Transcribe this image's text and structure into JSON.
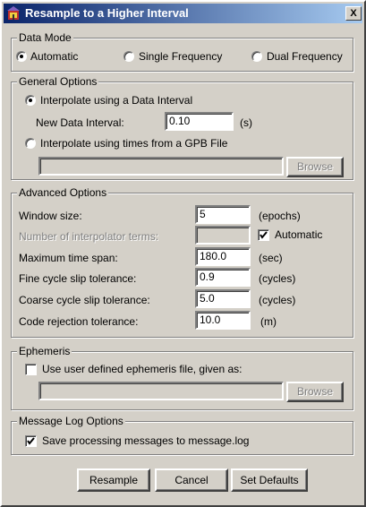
{
  "window": {
    "title": "Resample to a Higher Interval",
    "close_glyph": "X",
    "icon": "app-icon"
  },
  "data_mode": {
    "legend": "Data Mode",
    "options": [
      "Automatic",
      "Single Frequency",
      "Dual Frequency"
    ],
    "selected": "Automatic"
  },
  "general_options": {
    "legend": "General Options",
    "interpolate_interval_label": "Interpolate using a Data Interval",
    "interpolate_interval_selected": true,
    "new_data_interval_label": "New Data Interval:",
    "new_data_interval_value": "0.10",
    "new_data_interval_unit": "(s)",
    "interpolate_gpb_label": "Interpolate using times from a GPB File",
    "interpolate_gpb_selected": false,
    "gpb_file_value": "",
    "browse_label": "Browse"
  },
  "advanced_options": {
    "legend": "Advanced Options",
    "rows": [
      {
        "label": "Window size:",
        "value": "5",
        "unit": "(epochs)"
      },
      {
        "label": "Number of interpolator terms:",
        "value": "",
        "unit": "",
        "disabled": true,
        "checkbox_label": "Automatic",
        "checkbox_checked": true
      },
      {
        "label": "Maximum time span:",
        "value": "180.0",
        "unit": "(sec)"
      },
      {
        "label": "Fine cycle slip tolerance:",
        "value": "0.9",
        "unit": "(cycles)"
      },
      {
        "label": "Coarse cycle slip tolerance:",
        "value": "5.0",
        "unit": "(cycles)"
      },
      {
        "label": "Code rejection tolerance:",
        "value": "10.0",
        "unit": "(m)"
      }
    ]
  },
  "ephemeris": {
    "legend": "Ephemeris",
    "checkbox_label": "Use user defined ephemeris file, given as:",
    "checkbox_checked": false,
    "file_value": "",
    "browse_label": "Browse"
  },
  "message_log": {
    "legend": "Message Log Options",
    "checkbox_label": "Save processing messages to message.log",
    "checkbox_checked": true
  },
  "buttons": {
    "resample": "Resample",
    "cancel": "Cancel",
    "set_defaults": "Set Defaults"
  }
}
